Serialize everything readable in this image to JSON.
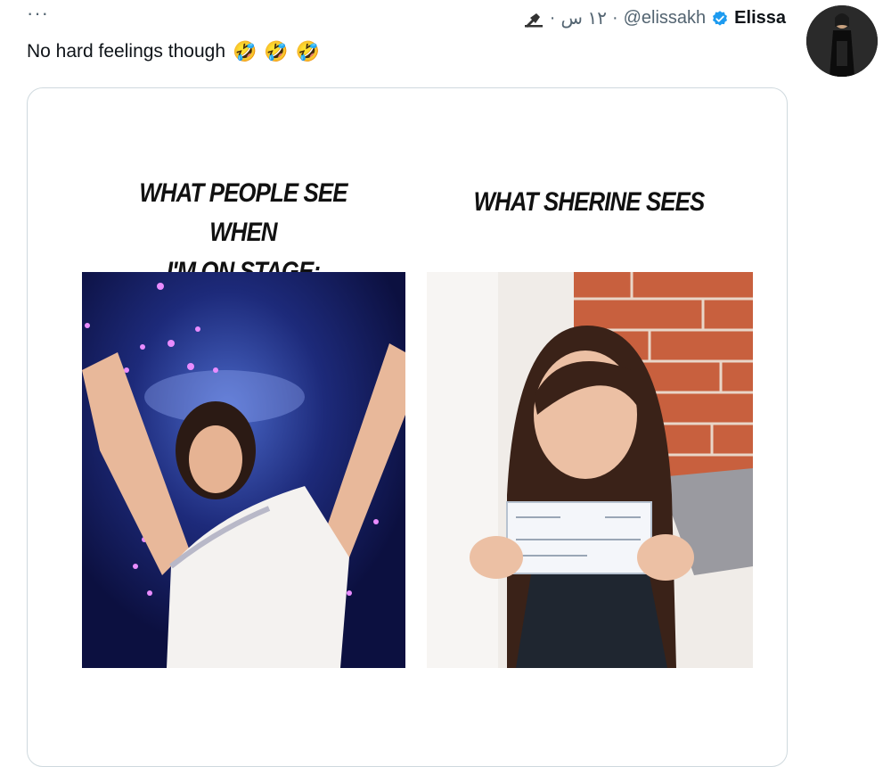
{
  "tweet": {
    "more_label": "···",
    "display_name": "Elissa",
    "handle": "@elissakh",
    "separator": "·",
    "time": "١٢ س",
    "text": "No hard feelings though",
    "emojis": [
      "🤣",
      "🤣",
      "🤣"
    ]
  },
  "meme": {
    "left_caption_line1": "WHAT PEOPLE SEE WHEN",
    "left_caption_line2": "I'M ON STAGE:",
    "right_caption": "WHAT SHERINE SEES"
  },
  "colors": {
    "verified": "#1d9bf0",
    "secondary_text": "#536471",
    "border": "#cfd9de"
  },
  "icons": [
    "more-icon",
    "verified-badge-icon",
    "pin-icon"
  ]
}
